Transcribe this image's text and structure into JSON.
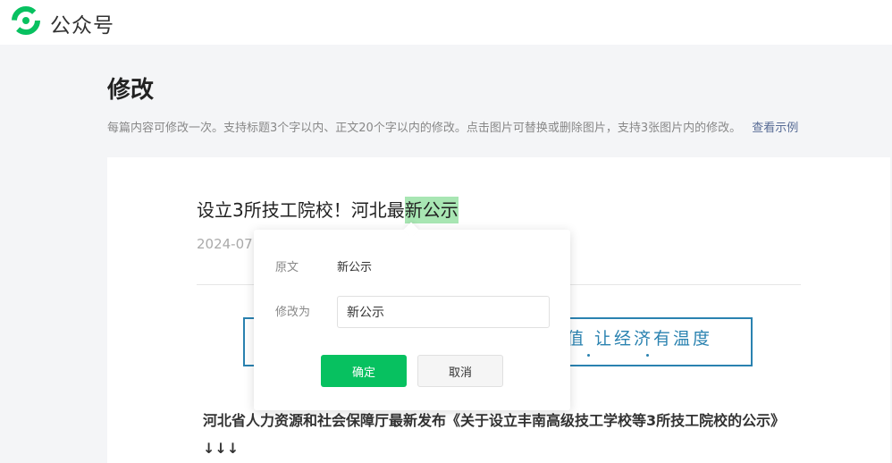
{
  "header": {
    "brand": "公众号",
    "logo_icon": "wechat-official-account-logo",
    "logo_color": "#07c160"
  },
  "page": {
    "title": "修改",
    "description": "每篇内容可修改一次。支持标题3个字以内、正文20个字以内的修改。点击图片可替换或删除图片，支持3张图片内的修改。",
    "example_link": "查看示例"
  },
  "article": {
    "title_prefix": "设立3所技工院校！河北最",
    "title_highlight": "新公示",
    "date_partial": "2024-07",
    "banner_text": "值 让经济有温度",
    "body_text": "河北省人力资源和社会保障厅最新发布《关于设立丰南高级技工学校等3所技工院校的公示》↓↓↓"
  },
  "edit_popover": {
    "original_label": "原文",
    "original_value": "新公示",
    "modify_label": "修改为",
    "modify_value": "新公示",
    "confirm_label": "确定",
    "cancel_label": "取消"
  },
  "colors": {
    "accent": "#07c160",
    "highlight": "#a8e6b3",
    "link": "#576b95",
    "banner": "#2a82b0"
  }
}
